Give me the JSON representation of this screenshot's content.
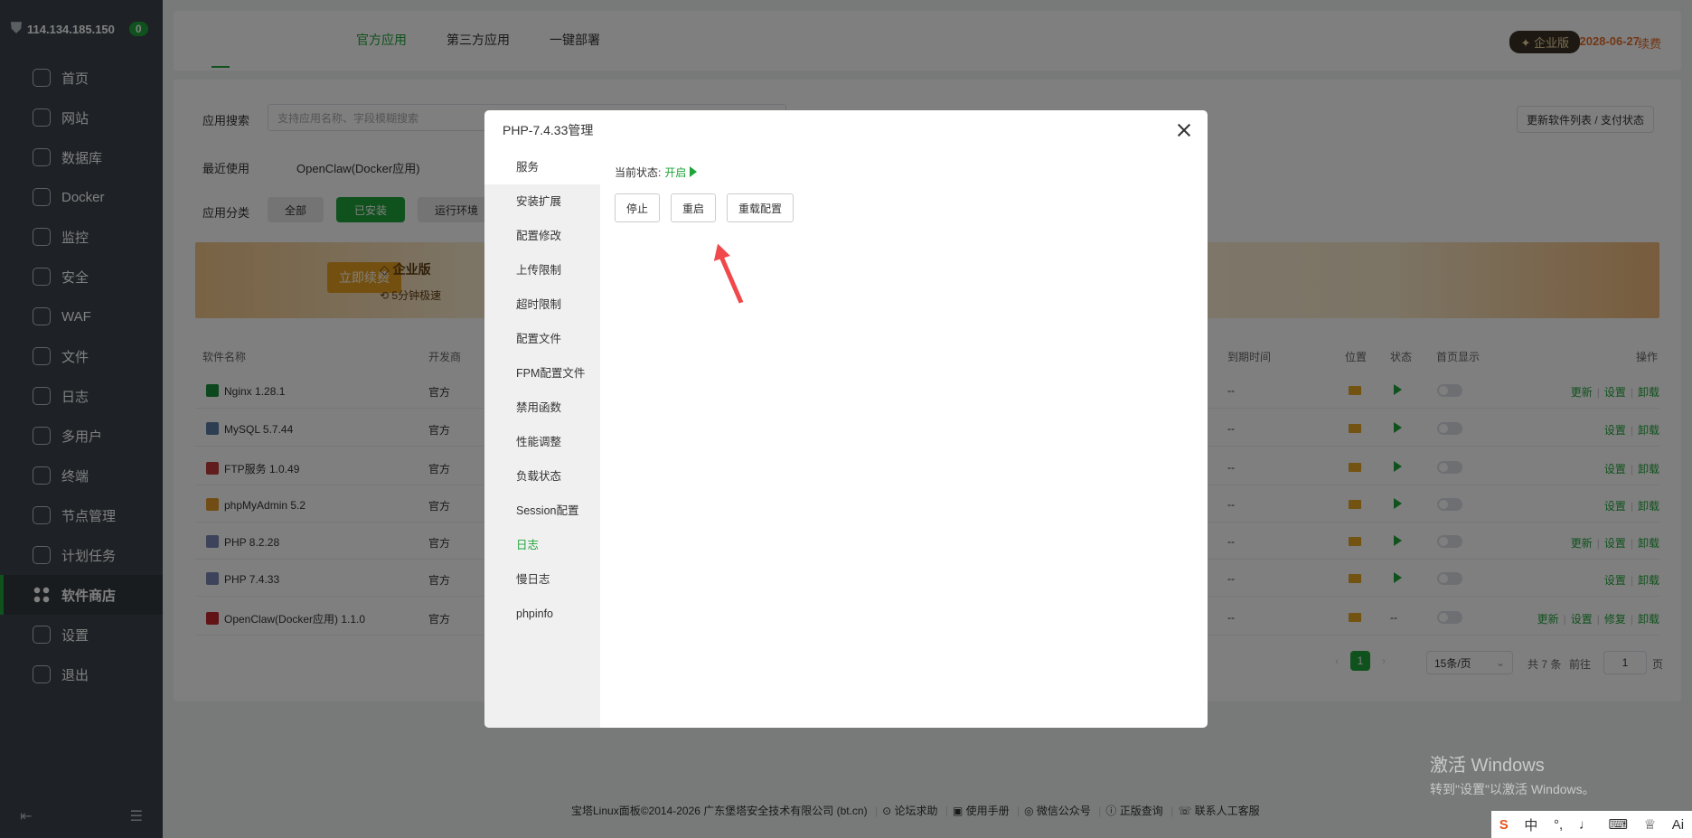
{
  "sidebar": {
    "ip": "114.134.185.150",
    "badge": "0",
    "items": [
      {
        "label": "首页",
        "icon": "home-icon"
      },
      {
        "label": "网站",
        "icon": "globe-icon"
      },
      {
        "label": "数据库",
        "icon": "database-icon"
      },
      {
        "label": "Docker",
        "icon": "docker-icon"
      },
      {
        "label": "监控",
        "icon": "monitor-icon"
      },
      {
        "label": "安全",
        "icon": "shield-icon"
      },
      {
        "label": "WAF",
        "icon": "waf-icon"
      },
      {
        "label": "文件",
        "icon": "folder-icon"
      },
      {
        "label": "日志",
        "icon": "log-icon"
      },
      {
        "label": "多用户",
        "icon": "users-icon"
      },
      {
        "label": "终端",
        "icon": "terminal-icon"
      },
      {
        "label": "节点管理",
        "icon": "node-icon"
      },
      {
        "label": "计划任务",
        "icon": "calendar-icon"
      },
      {
        "label": "软件商店",
        "icon": "store-icon"
      },
      {
        "label": "设置",
        "icon": "gear-icon"
      },
      {
        "label": "退出",
        "icon": "logout-icon"
      }
    ]
  },
  "header": {
    "tabs": [
      "官方应用",
      "第三方应用",
      "一键部署"
    ],
    "edition": "企业版",
    "expire": "2028-06-27",
    "renew": "续费"
  },
  "store": {
    "search_label": "应用搜索",
    "search_placeholder": "支持应用名称、字段模糊搜索",
    "update_btn": "更新软件列表 / 支付状态",
    "recent_label": "最近使用",
    "recent_app": "OpenClaw(Docker应用)",
    "category_label": "应用分类",
    "categories": [
      "全部",
      "已安装",
      "运行环境"
    ],
    "banner": {
      "button": "立即续费",
      "title": "企业版",
      "sub": "5分钟极速"
    },
    "columns": {
      "name": "软件名称",
      "dev": "开发商",
      "expire": "到期时间",
      "pos": "位置",
      "status": "状态",
      "home": "首页显示",
      "ops": "操作"
    },
    "rows": [
      {
        "name": "Nginx 1.28.1",
        "dev": "官方",
        "expire": "--",
        "ops": [
          "更新",
          "设置",
          "卸载"
        ],
        "icon": "nginx-icon"
      },
      {
        "name": "MySQL 5.7.44",
        "dev": "官方",
        "expire": "--",
        "ops": [
          "设置",
          "卸载"
        ],
        "icon": "mysql-icon"
      },
      {
        "name": "FTP服务 1.0.49",
        "dev": "官方",
        "expire": "--",
        "ops": [
          "设置",
          "卸载"
        ],
        "icon": "ftp-icon"
      },
      {
        "name": "phpMyAdmin 5.2",
        "dev": "官方",
        "expire": "--",
        "ops": [
          "设置",
          "卸载"
        ],
        "icon": "phpmyadmin-icon"
      },
      {
        "name": "PHP 8.2.28",
        "dev": "官方",
        "expire": "--",
        "ops": [
          "更新",
          "设置",
          "卸载"
        ],
        "icon": "php-icon"
      },
      {
        "name": "PHP 7.4.33",
        "dev": "官方",
        "expire": "--",
        "ops": [
          "设置",
          "卸载"
        ],
        "icon": "php-icon"
      },
      {
        "name": "OpenClaw(Docker应用) 1.1.0",
        "dev": "官方",
        "expire": "--",
        "status_text": "--",
        "ops": [
          "更新",
          "设置",
          "修复",
          "卸载"
        ],
        "icon": "openclaw-icon"
      }
    ],
    "pager": {
      "page": "1",
      "per_page": "15条/页",
      "total": "共 7 条",
      "goto": "前往",
      "goto_val": "1",
      "unit": "页"
    }
  },
  "modal": {
    "title": "PHP-7.4.33管理",
    "nav": [
      "服务",
      "安装扩展",
      "配置修改",
      "上传限制",
      "超时限制",
      "配置文件",
      "FPM配置文件",
      "禁用函数",
      "性能调整",
      "负载状态",
      "Session配置",
      "日志",
      "慢日志",
      "phpinfo"
    ],
    "status_label": "当前状态:",
    "status_value": "开启",
    "buttons": [
      "停止",
      "重启",
      "重载配置"
    ]
  },
  "footer": {
    "copyright": "宝塔Linux面板©2014-2026 广东堡塔安全技术有限公司 (bt.cn)",
    "links": [
      "论坛求助",
      "使用手册",
      "微信公众号",
      "正版查询",
      "联系人工客服"
    ]
  },
  "watermark": {
    "line1": "激活 Windows",
    "line2": "转到\"设置\"以激活 Windows。"
  },
  "ime": [
    "中",
    "Ai"
  ],
  "colors": {
    "accent": "#20a53a",
    "sidebar": "#3c444d",
    "warning": "#e56e2d",
    "annotation": "#f0484b"
  }
}
